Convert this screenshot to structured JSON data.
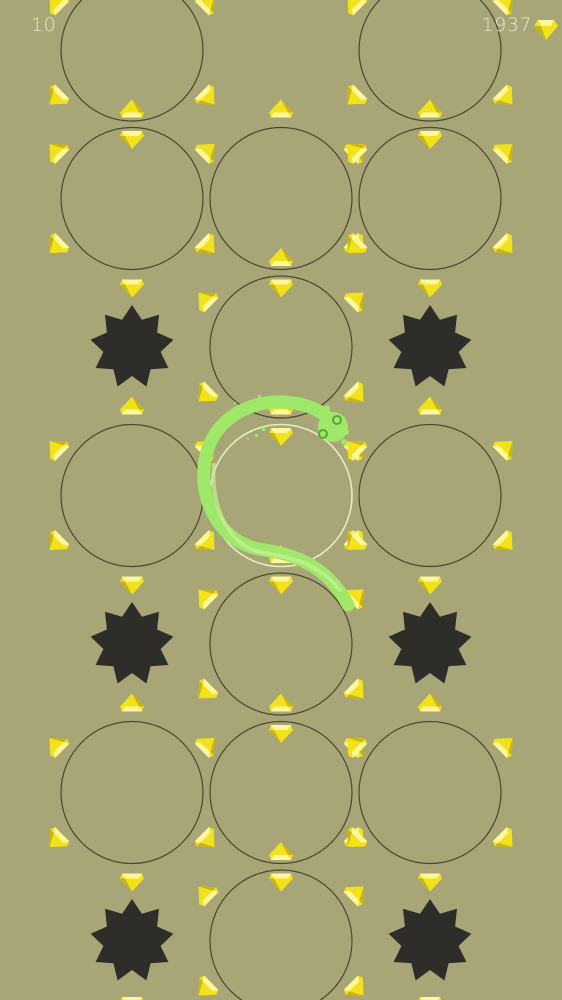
{
  "hud": {
    "level": "10",
    "gem_count": "1937",
    "gem_icon": "diamond-icon"
  },
  "colors": {
    "background": "#a8a677",
    "ring": "#4a4930",
    "active_ring": "#e8f0c8",
    "snake": "#9fe86a",
    "snake_light": "#c6f29a",
    "spike": "#2e2d2a",
    "gem": "#f2e21a",
    "gem_light": "#fff6a0",
    "gem_dark": "#c9b50c",
    "hud_text": "#e7e6cc"
  },
  "board": {
    "columns": 3,
    "rows": 7,
    "rings": [
      [
        1,
        0,
        1
      ],
      [
        1,
        1,
        1
      ],
      [
        0,
        1,
        0
      ],
      [
        1,
        2,
        1
      ],
      [
        0,
        1,
        0
      ],
      [
        1,
        1,
        1
      ],
      [
        0,
        1,
        0
      ]
    ],
    "spikes": [
      [
        2,
        0
      ],
      [
        2,
        2
      ],
      [
        4,
        0
      ],
      [
        4,
        2
      ],
      [
        6,
        0
      ],
      [
        6,
        2
      ]
    ],
    "gem_icon": "diamond-icon",
    "spike_icon": "spike-mine-icon"
  }
}
